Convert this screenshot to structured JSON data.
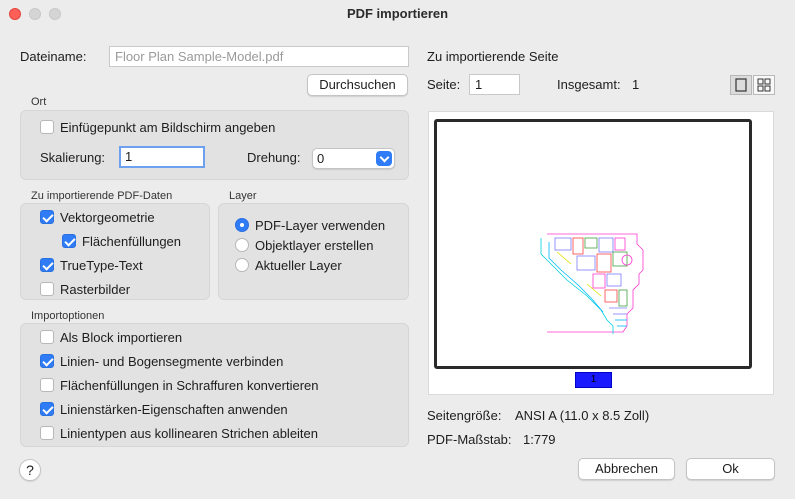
{
  "window": {
    "title": "PDF importieren"
  },
  "file": {
    "label": "Dateiname:",
    "value": "Floor Plan Sample-Model.pdf",
    "browse_button": "Durchsuchen"
  },
  "location": {
    "group_label": "Ort",
    "specify_on_screen": {
      "label": "Einfügepunkt am Bildschirm angeben",
      "checked": false
    },
    "scale_label": "Skalierung:",
    "scale_value": "1",
    "rotation_label": "Drehung:",
    "rotation_value": "0"
  },
  "pdf_data": {
    "group_label": "Zu importierende PDF-Daten",
    "items": [
      {
        "label": "Vektorgeometrie",
        "checked": true
      },
      {
        "label": "Flächenfüllungen",
        "checked": true
      },
      {
        "label": "TrueType-Text",
        "checked": true
      },
      {
        "label": "Rasterbilder",
        "checked": false
      }
    ]
  },
  "layer": {
    "group_label": "Layer",
    "options": [
      {
        "label": "PDF-Layer verwenden",
        "selected": true
      },
      {
        "label": "Objektlayer erstellen",
        "selected": false
      },
      {
        "label": "Aktueller Layer",
        "selected": false
      }
    ]
  },
  "import_options": {
    "group_label": "Importoptionen",
    "items": [
      {
        "label": "Als Block importieren",
        "checked": false
      },
      {
        "label": "Linien- und Bogensegmente verbinden",
        "checked": true
      },
      {
        "label": "Flächenfüllungen in Schraffuren konvertieren",
        "checked": false
      },
      {
        "label": "Linienstärken-Eigenschaften anwenden",
        "checked": true
      },
      {
        "label": "Linientypen aus kollinearen Strichen ableiten",
        "checked": false
      }
    ]
  },
  "page": {
    "heading": "Zu importierende Seite",
    "page_label": "Seite:",
    "page_value": "1",
    "total_label": "Insgesamt:",
    "total_value": "1",
    "thumbnail_label": "1",
    "size_label": "Seitengröße:",
    "size_value": "ANSI A (11.0 x 8.5 Zoll)",
    "scale_label": "PDF-Maßstab:",
    "scale_value": "1:779"
  },
  "footer": {
    "help": "?",
    "cancel": "Abbrechen",
    "ok": "Ok"
  },
  "colors": {
    "accent": "#2f7cf6",
    "close": "#fe5f57",
    "thumbnail_tab": "#1a1aff"
  },
  "icons": [
    "single-page-view-icon",
    "grid-view-icon",
    "chevron-down-icon",
    "checkmark-icon"
  ]
}
